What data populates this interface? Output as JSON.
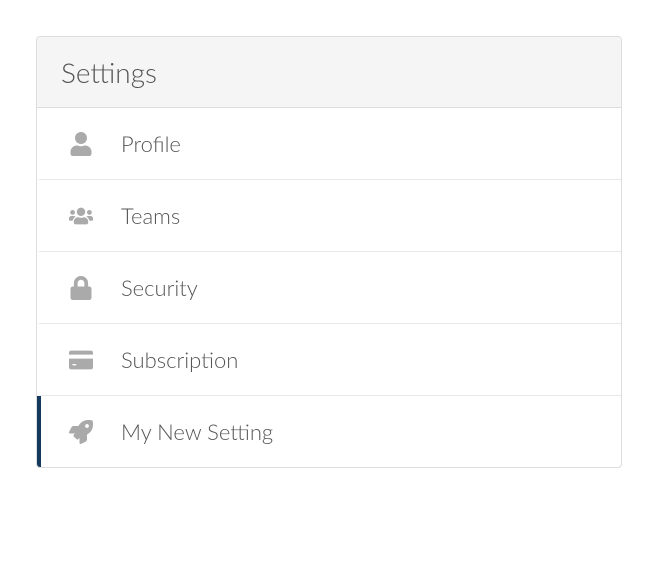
{
  "settings": {
    "title": "Settings",
    "items": [
      {
        "label": "Profile",
        "icon": "user-icon",
        "active": false
      },
      {
        "label": "Teams",
        "icon": "users-icon",
        "active": false
      },
      {
        "label": "Security",
        "icon": "lock-icon",
        "active": false
      },
      {
        "label": "Subscription",
        "icon": "credit-card-icon",
        "active": false
      },
      {
        "label": "My New Setting",
        "icon": "rocket-icon",
        "active": true
      }
    ]
  }
}
